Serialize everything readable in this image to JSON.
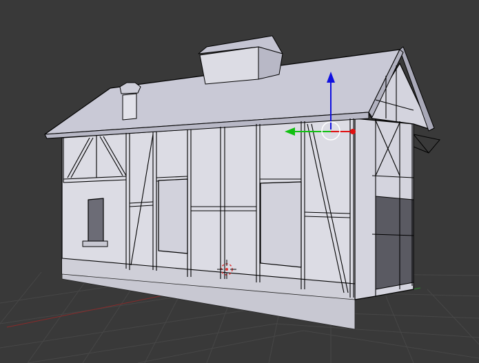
{
  "app": {
    "name": "",
    "view": "3d-viewport"
  },
  "scene": {
    "background": "#393939",
    "grid_color": "#474747",
    "model": "half-timbered-house",
    "shading": "solid",
    "mode": "edit",
    "wall_color": "#dcdce4",
    "roof_color": "#c9c9d6",
    "edge_color": "#000000"
  },
  "gizmo": {
    "x_color": "#e01010",
    "y_color": "#10c010",
    "z_color": "#1010e0",
    "center_color": "#ffffff"
  },
  "icons": {
    "cursor": "3d-cursor-icon",
    "manipulator": "transform-manipulator-icon",
    "camera": "camera-icon"
  }
}
